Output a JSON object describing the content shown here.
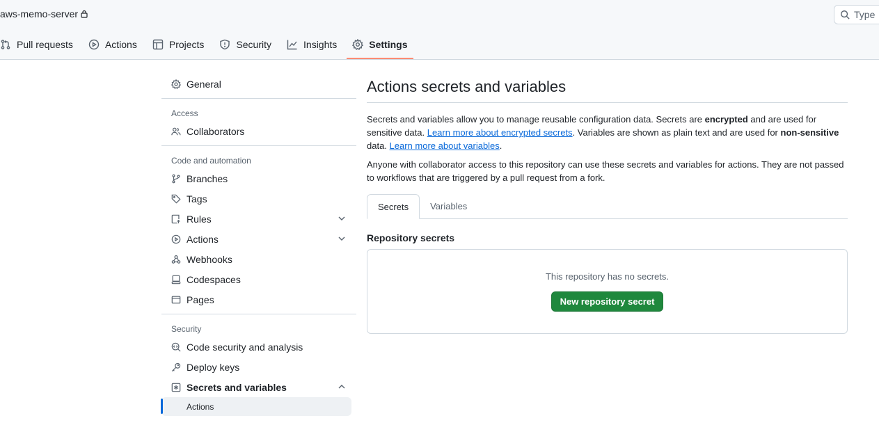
{
  "header": {
    "repo_name": "aws-memo-server",
    "search_placeholder": "Type",
    "search_key": "/"
  },
  "repo_nav": [
    {
      "label": "Pull requests",
      "icon": "pull-request-icon"
    },
    {
      "label": "Actions",
      "icon": "play-icon"
    },
    {
      "label": "Projects",
      "icon": "table-icon"
    },
    {
      "label": "Security",
      "icon": "shield-icon"
    },
    {
      "label": "Insights",
      "icon": "graph-icon"
    },
    {
      "label": "Settings",
      "icon": "gear-icon",
      "selected": true
    }
  ],
  "sidebar": {
    "general": "General",
    "access_heading": "Access",
    "collaborators": "Collaborators",
    "code_heading": "Code and automation",
    "branches": "Branches",
    "tags": "Tags",
    "rules": "Rules",
    "actions": "Actions",
    "webhooks": "Webhooks",
    "codespaces": "Codespaces",
    "pages": "Pages",
    "security_heading": "Security",
    "code_security": "Code security and analysis",
    "deploy_keys": "Deploy keys",
    "secrets_variables": "Secrets and variables",
    "sub_actions": "Actions"
  },
  "main": {
    "title": "Actions secrets and variables",
    "desc_1": "Secrets and variables allow you to manage reusable configuration data. Secrets are ",
    "desc_encrypted": "encrypted",
    "desc_2": " and are used for sensitive data. ",
    "link_secrets": "Learn more about encrypted secrets",
    "desc_3": ". Variables are shown as plain text and are used for ",
    "desc_nonsensitive": "non-sensitive",
    "desc_4": " data. ",
    "link_variables": "Learn more about variables",
    "desc_5": ".",
    "desc_para2": "Anyone with collaborator access to this repository can use these secrets and variables for actions. They are not passed to workflows that are triggered by a pull request from a fork.",
    "tabs": [
      "Secrets",
      "Variables"
    ],
    "section_title": "Repository secrets",
    "empty_text": "This repository has no secrets.",
    "new_secret_button": "New repository secret"
  },
  "colors": {
    "accent": "#0969da",
    "primary_button": "#1f883d",
    "selected_underline": "#fd8c73"
  }
}
